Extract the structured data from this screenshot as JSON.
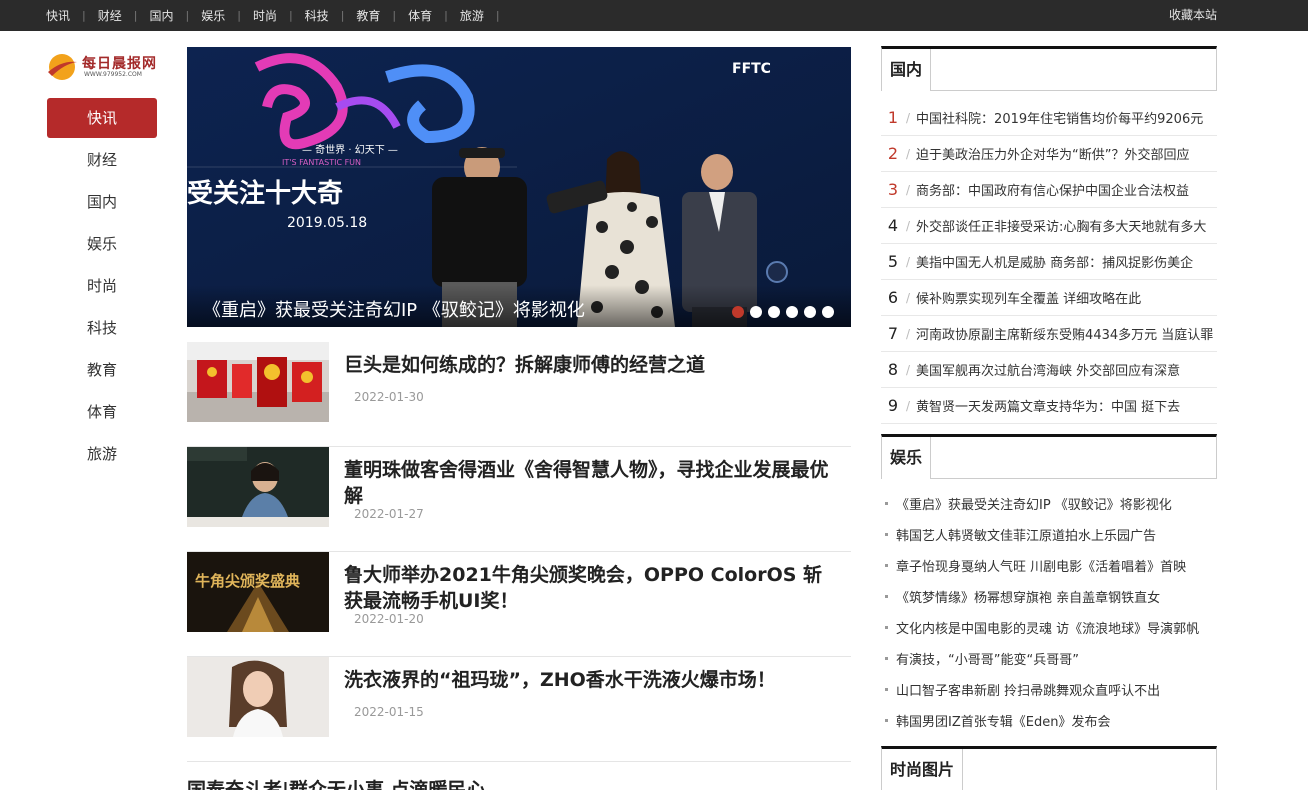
{
  "topnav": {
    "items": [
      "快讯",
      "财经",
      "国内",
      "娱乐",
      "时尚",
      "科技",
      "教育",
      "体育",
      "旅游"
    ],
    "favorite": "收藏本站"
  },
  "logo": {
    "name": "每日晨报网",
    "url": "WWW.979952.COM"
  },
  "sidenav": {
    "items": [
      "快讯",
      "财经",
      "国内",
      "娱乐",
      "时尚",
      "科技",
      "教育",
      "体育",
      "旅游"
    ],
    "active_index": 0
  },
  "banner": {
    "caption": "《重启》获最受关注奇幻IP 《驭鲛记》将影视化",
    "image_text": {
      "logo": "FFTC",
      "subtitle": "— 奇世界 · 幻天下 —",
      "subtitle_en": "IT'S FANTASTIC FUN",
      "headline": "受关注十大奇",
      "date": "2019.05.18"
    },
    "dots": 6,
    "active_dot": 0
  },
  "articles": [
    {
      "title": "巨头是如何练成的？拆解康师傅的经营之道",
      "date": "2022-01-30"
    },
    {
      "title": "董明珠做客舍得酒业《舍得智慧人物》，寻找企业发展最优解",
      "date": "2022-01-27"
    },
    {
      "title": "鲁大师举办2021牛角尖颁奖晚会，OPPO ColorOS 斩获最流畅手机UI奖！",
      "date": "2022-01-20",
      "thumb_text": "牛角尖颁奖盛典"
    },
    {
      "title": "洗衣液界的“祖玛珑”，ZHO香水干洗液火爆市场！",
      "date": "2022-01-15"
    }
  ],
  "partial_article": {
    "title": "国泰奋斗者|群众无小事 点滴暖民心"
  },
  "domestic": {
    "tab": "国内",
    "items": [
      "中国社科院：2019年住宅销售均价每平约9206元",
      "迫于美政治压力外企对华为“断供”？外交部回应",
      "商务部：中国政府有信心保护中国企业合法权益",
      "外交部谈任正非接受采访:心胸有多大天地就有多大",
      "美指中国无人机是威胁 商务部：捕风捉影伤美企",
      "候补购票实现列车全覆盖 详细攻略在此",
      "河南政协原副主席靳绥东受贿4434多万元 当庭认罪",
      "美国军舰再次过航台湾海峡 外交部回应有深意",
      "黄智贤一天发两篇文章支持华为：中国 挺下去"
    ]
  },
  "entertainment": {
    "tab": "娱乐",
    "items": [
      "《重启》获最受关注奇幻IP 《驭鲛记》将影视化",
      "韩国艺人韩贤敏文佳菲江原道拍水上乐园广告",
      "章子怡现身戛纳人气旺 川剧电影《活着唱着》首映",
      "《筑梦情缘》杨幂想穿旗袍 亲自盖章钢铁直女",
      "文化内核是中国电影的灵魂 访《流浪地球》导演郭帆",
      "有演技，“小哥哥”能变“兵哥哥”",
      "山口智子客串新剧 拎扫帚跳舞观众直呼认不出",
      "韩国男团IZ首张专辑《Eden》发布会"
    ]
  },
  "fashion": {
    "tab": "时尚图片"
  }
}
